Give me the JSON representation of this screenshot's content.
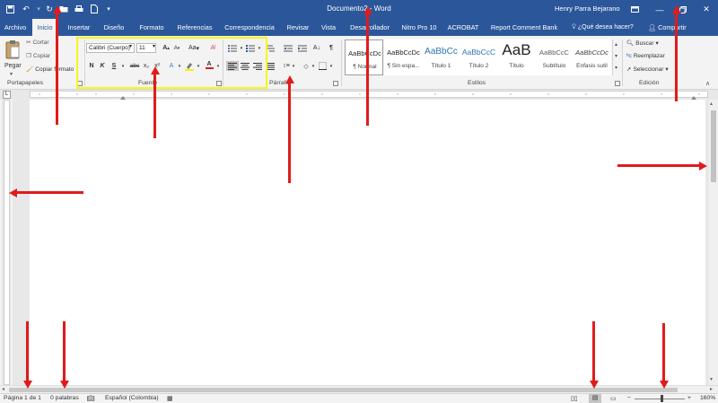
{
  "colors": {
    "title_bar": "#2b579a",
    "annotation": "#e01b1b",
    "highlight_box": "#f7f71a"
  },
  "title_bar": {
    "document_title": "Documento2  -  Word",
    "user_name": "Henry Parra Bejarano",
    "quick_access": [
      "save-icon",
      "undo-icon",
      "redo-icon",
      "open-icon",
      "print-icon",
      "new-document-icon",
      "customize-icon"
    ]
  },
  "tabs": [
    {
      "label": "Archivo"
    },
    {
      "label": "Inicio"
    },
    {
      "label": "Insertar"
    },
    {
      "label": "Diseño"
    },
    {
      "label": "Formato"
    },
    {
      "label": "Referencias"
    },
    {
      "label": "Correspondencia"
    },
    {
      "label": "Revisar"
    },
    {
      "label": "Vista"
    },
    {
      "label": "Desarrollador"
    },
    {
      "label": "Nitro Pro 10"
    },
    {
      "label": "ACROBAT"
    },
    {
      "label": "Report Comment Bank"
    }
  ],
  "active_tab": "Inicio",
  "tell_me": "¿Qué desea hacer?",
  "share": "Compartir",
  "ribbon": {
    "clipboard": {
      "paste": "Pegar",
      "cut": "Cortar",
      "copy": "Copiar",
      "format_painter": "Copiar formato",
      "label": "Portapapeles"
    },
    "font": {
      "font_name": "Calibri (Cuerpo)",
      "font_size": "11",
      "label": "Fuente",
      "bold": "N",
      "italic": "K",
      "underline": "S",
      "strikethrough": "abc",
      "subscript": "x₂",
      "superscript": "x²",
      "change_case": "Aa",
      "font_color_letter": "A"
    },
    "paragraph": {
      "label": "Párrafo",
      "show_marks": "¶"
    },
    "styles": {
      "label": "Estilos",
      "items": [
        {
          "sample": "AaBbCcDc",
          "name": "¶ Normal"
        },
        {
          "sample": "AaBbCcDc",
          "name": "¶ Sin espa..."
        },
        {
          "sample": "AaBbCc",
          "name": "Título 1"
        },
        {
          "sample": "AaBbCcC",
          "name": "Título 2"
        },
        {
          "sample": "AaB",
          "name": "Título"
        },
        {
          "sample": "AaBbCcC",
          "name": "Subtítulo"
        },
        {
          "sample": "AaBbCcDc",
          "name": "Énfasis sutil"
        }
      ]
    },
    "editing": {
      "label": "Edición",
      "find": "Buscar",
      "replace": "Reemplazar",
      "select": "Seleccionar"
    }
  },
  "status_bar": {
    "page": "Página 1 de 1",
    "words": "0 palabras",
    "language": "Español (Colombia)",
    "zoom": "160%",
    "zoom_minus": "−",
    "zoom_plus": "+"
  }
}
